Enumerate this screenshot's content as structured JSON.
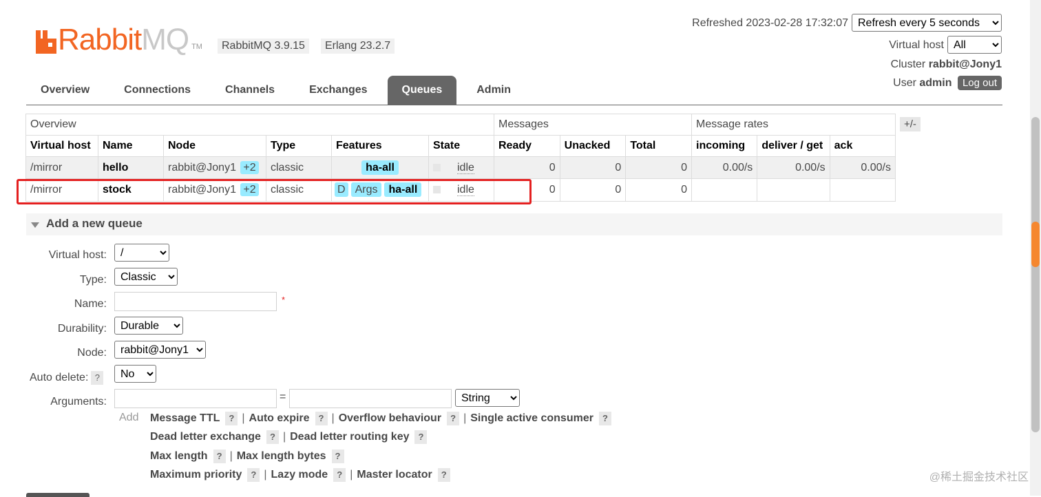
{
  "brand": {
    "name_a": "Rabbit",
    "name_b": "MQ",
    "tm": "TM"
  },
  "versions": {
    "rabbitmq": "RabbitMQ 3.9.15",
    "erlang": "Erlang 23.2.7"
  },
  "header": {
    "refreshed": "Refreshed 2023-02-28 17:32:07",
    "refresh_option": "Refresh every 5 seconds",
    "virtual_host_label": "Virtual host",
    "virtual_host_value": "All",
    "cluster_label": "Cluster",
    "cluster_value": "rabbit@Jony1",
    "user_label": "User",
    "user_value": "admin",
    "logout": "Log out"
  },
  "tabs": [
    "Overview",
    "Connections",
    "Channels",
    "Exchanges",
    "Queues",
    "Admin"
  ],
  "active_tab": "Queues",
  "table": {
    "groups": {
      "overview": "Overview",
      "messages": "Messages",
      "rates": "Message rates"
    },
    "toggle": "+/-",
    "columns": [
      "Virtual host",
      "Name",
      "Node",
      "Type",
      "Features",
      "State",
      "Ready",
      "Unacked",
      "Total",
      "incoming",
      "deliver / get",
      "ack"
    ],
    "rows": [
      {
        "vhost": "/mirror",
        "name": "hello",
        "node": "rabbit@Jony1",
        "node_extra": "+2",
        "type": "classic",
        "features": [
          "ha-all"
        ],
        "state": "idle",
        "ready": "0",
        "unacked": "0",
        "total": "0",
        "incoming": "0.00/s",
        "deliver": "0.00/s",
        "ack": "0.00/s"
      },
      {
        "vhost": "/mirror",
        "name": "stock",
        "node": "rabbit@Jony1",
        "node_extra": "+2",
        "type": "classic",
        "features": [
          "D",
          "Args",
          "ha-all"
        ],
        "state": "idle",
        "ready": "0",
        "unacked": "0",
        "total": "0",
        "incoming": "",
        "deliver": "",
        "ack": ""
      }
    ]
  },
  "add_queue": {
    "title": "Add a new queue",
    "virtual_host_label": "Virtual host:",
    "virtual_host_value": "/",
    "type_label": "Type:",
    "type_value": "Classic",
    "name_label": "Name:",
    "required_mark": "*",
    "durability_label": "Durability:",
    "durability_value": "Durable",
    "node_label": "Node:",
    "node_value": "rabbit@Jony1",
    "auto_delete_label": "Auto delete:",
    "auto_delete_value": "No",
    "arguments_label": "Arguments:",
    "equals": "=",
    "arg_type_value": "String",
    "add_label": "Add",
    "help": "?",
    "arg_separator": "|",
    "arg_links": [
      [
        "Message TTL",
        "Auto expire",
        "Overflow behaviour",
        "Single active consumer"
      ],
      [
        "Dead letter exchange",
        "Dead letter routing key"
      ],
      [
        "Max length",
        "Max length bytes"
      ],
      [
        "Maximum priority",
        "Lazy mode",
        "Master locator"
      ]
    ]
  },
  "watermark": "@稀土掘金技术社区",
  "colors": {
    "brand_orange": "#f26522",
    "tab_active": "#666666",
    "feature_badge": "#99ebff",
    "highlight_red": "#e42020"
  }
}
